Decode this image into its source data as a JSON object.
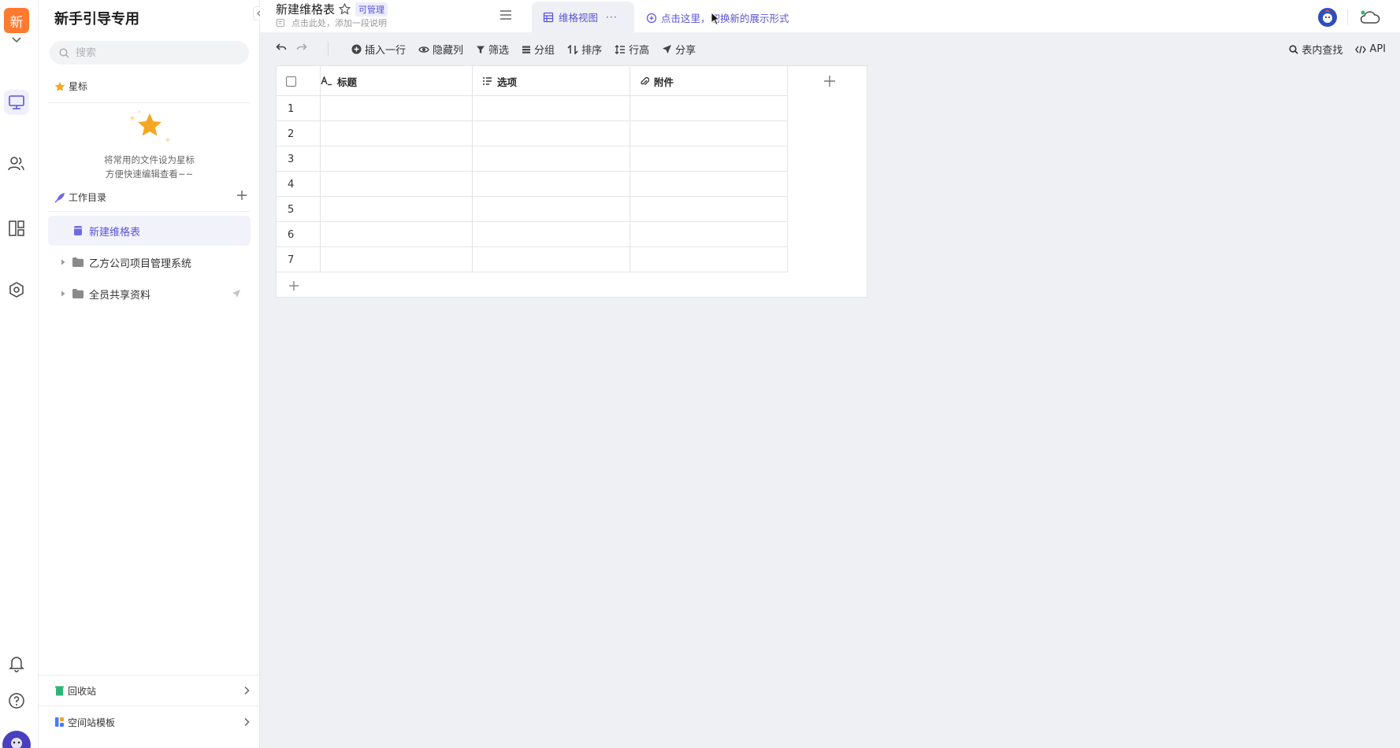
{
  "space": {
    "avatar_char": "新",
    "name": "新手引导专用",
    "accent": "#ff7a2e"
  },
  "sidebar": {
    "search_placeholder": "搜索",
    "starred": {
      "label": "星标",
      "empty_line1": "将常用的文件设为星标",
      "empty_line2": "方便快速编辑查看~~"
    },
    "workdir": {
      "label": "工作目录",
      "items": [
        {
          "label": "新建维格表",
          "type": "datasheet",
          "active": true
        },
        {
          "label": "乙方公司项目管理系统",
          "type": "folder",
          "active": false
        },
        {
          "label": "全员共享资料",
          "type": "folder",
          "active": false,
          "shared": true
        }
      ]
    },
    "bottom": {
      "trash": "回收站",
      "templates": "空间站模板"
    }
  },
  "header": {
    "title": "新建维格表",
    "permission": "可管理",
    "description_placeholder": "点击此处，添加一段说明",
    "view_tab": "维格视图",
    "view_more": "···",
    "add_view_hint": "点击这里，切换新的展示形式"
  },
  "toolbar": {
    "insert_row": "插入一行",
    "hide_columns": "隐藏列",
    "filter": "筛选",
    "group": "分组",
    "sort": "排序",
    "row_height": "行高",
    "share": "分享",
    "find": "表内查找",
    "api": "API"
  },
  "grid": {
    "columns": [
      {
        "name": "标题",
        "icon": "text-field-icon"
      },
      {
        "name": "选项",
        "icon": "select-field-icon"
      },
      {
        "name": "附件",
        "icon": "attachment-field-icon"
      }
    ],
    "rows": [
      "1",
      "2",
      "3",
      "4",
      "5",
      "6",
      "7"
    ]
  },
  "colors": {
    "primary": "#5a55d6",
    "canvas": "#eff0f4",
    "star": "#f5a623"
  }
}
